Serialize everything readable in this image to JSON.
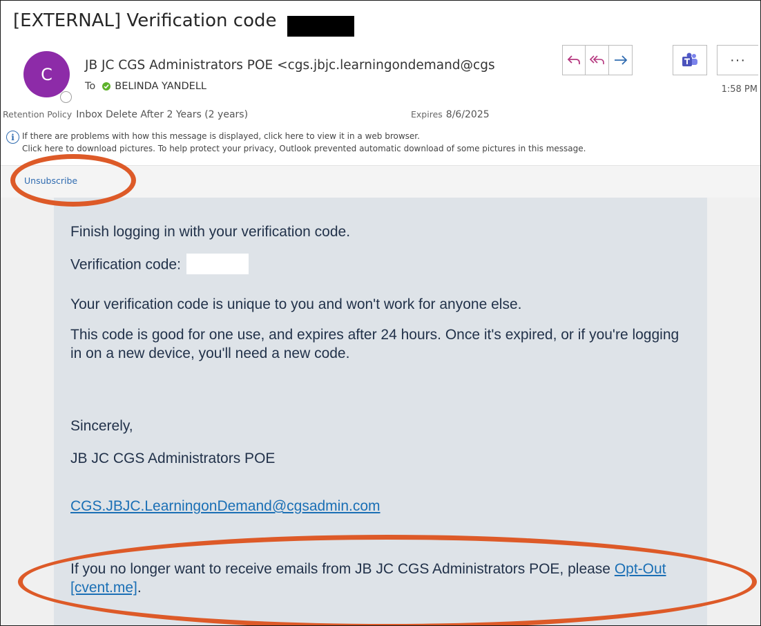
{
  "subject": "[EXTERNAL] Verification code",
  "sender": {
    "avatar_initial": "C",
    "display": "JB JC CGS Administrators POE <cgs.jbjc.learningondemand@cgs",
    "to_label": "To",
    "to_name": "BELINDA YANDELL",
    "time": "1:58 PM"
  },
  "toolbar": {
    "reply_icon": "reply-icon",
    "reply_all_icon": "reply-all-icon",
    "forward_icon": "forward-icon",
    "teams_icon": "teams-icon",
    "more_label": "···"
  },
  "retention": {
    "label": "Retention Policy",
    "value": "Inbox Delete After 2 Years (2 years)",
    "expires_label": "Expires",
    "expires_value": "8/6/2025"
  },
  "info": {
    "line1": "If there are problems with how this message is displayed, click here to view it in a web browser.",
    "line2": "Click here to download pictures. To help protect your privacy, Outlook prevented automatic download of some pictures in this message."
  },
  "unsubscribe": "Unsubscribe",
  "body": {
    "intro": "Finish logging in with your verification code.",
    "code_label": "Verification code:",
    "unique": "Your verification code is unique to you and won't work for anyone else.",
    "expiry": "This code is good for one use, and expires after 24 hours. Once it's expired, or if you're logging in on a new device, you'll need a new code.",
    "closing": "Sincerely,",
    "signature": "JB JC CGS Administrators POE",
    "email_link": "CGS.JBJC.LearningonDemand@cgsadmin.com",
    "optout_prefix": "If you no longer want to receive emails from JB JC CGS Administrators POE, please ",
    "optout_link": "Opt-Out [cvent.me]",
    "optout_suffix": "."
  },
  "colors": {
    "avatar": "#8d2ba8",
    "annotation": "#dd5a28",
    "link": "#1a6fb5",
    "email_bg": "#dee3e8"
  }
}
